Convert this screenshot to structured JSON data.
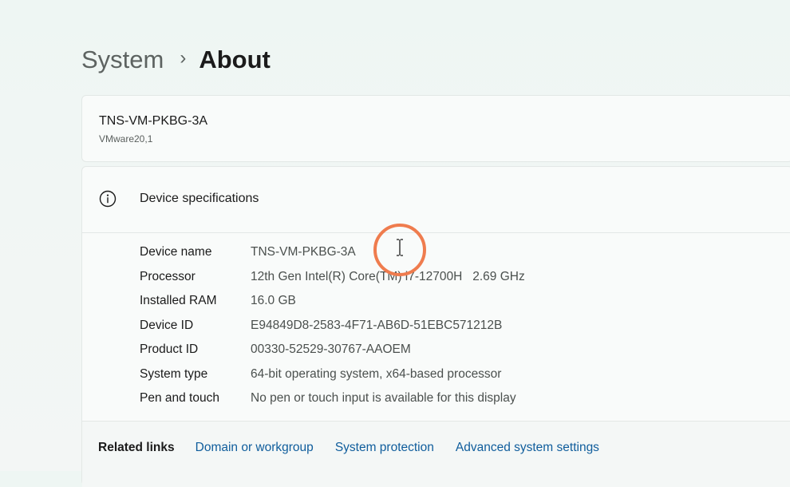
{
  "breadcrumb": {
    "parent": "System",
    "separator": "›",
    "current": "About"
  },
  "device": {
    "name": "TNS-VM-PKBG-3A",
    "model": "VMware20,1"
  },
  "specs": {
    "title": "Device specifications",
    "icon": "info-icon",
    "rows": [
      {
        "label": "Device name",
        "value": "TNS-VM-PKBG-3A"
      },
      {
        "label": "Processor",
        "value": "12th Gen Intel(R) Core(TM) i7-12700H   2.69 GHz"
      },
      {
        "label": "Installed RAM",
        "value": "16.0 GB"
      },
      {
        "label": "Device ID",
        "value": "E94849D8-2583-4F71-AB6D-51EBC571212B"
      },
      {
        "label": "Product ID",
        "value": "00330-52529-30767-AAOEM"
      },
      {
        "label": "System type",
        "value": "64-bit operating system, x64-based processor"
      },
      {
        "label": "Pen and touch",
        "value": "No pen or touch input is available for this display"
      }
    ]
  },
  "related": {
    "title": "Related links",
    "links": [
      "Domain or workgroup",
      "System protection",
      "Advanced system settings"
    ]
  },
  "colors": {
    "accent": "#0f5d9c",
    "highlight_ring": "#ef7c4e"
  }
}
